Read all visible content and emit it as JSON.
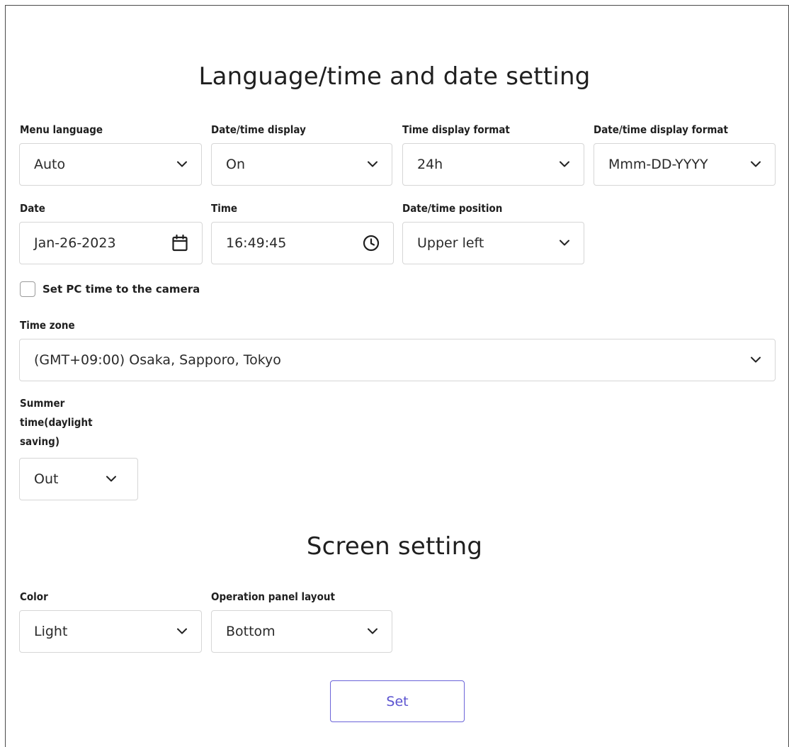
{
  "language_section": {
    "title": "Language/time and date setting",
    "menu_language": {
      "label": "Menu language",
      "value": "Auto"
    },
    "datetime_display": {
      "label": "Date/time display",
      "value": "On"
    },
    "time_display_format": {
      "label": "Time display format",
      "value": "24h"
    },
    "datetime_display_format": {
      "label": "Date/time display format",
      "value": "Mmm-DD-YYYY"
    },
    "date": {
      "label": "Date",
      "value": "Jan-26-2023",
      "icon": "calendar-icon"
    },
    "time": {
      "label": "Time",
      "value": "16:49:45",
      "icon": "clock-icon"
    },
    "datetime_position": {
      "label": "Date/time position",
      "value": "Upper left"
    },
    "set_pc_time": {
      "label": "Set PC time to the camera",
      "checked": false
    },
    "time_zone": {
      "label": "Time zone",
      "value": "(GMT+09:00) Osaka, Sapporo, Tokyo"
    },
    "summer_time": {
      "label_lines": [
        "Summer",
        "time(daylight",
        "saving)"
      ],
      "value": "Out"
    }
  },
  "screen_section": {
    "title": "Screen setting",
    "color": {
      "label": "Color",
      "value": "Light"
    },
    "operation_panel_layout": {
      "label": "Operation panel layout",
      "value": "Bottom"
    }
  },
  "actions": {
    "set_label": "Set"
  },
  "colors": {
    "accent": "#5b53d0",
    "border": "#d6d6d6",
    "text": "#222222"
  }
}
